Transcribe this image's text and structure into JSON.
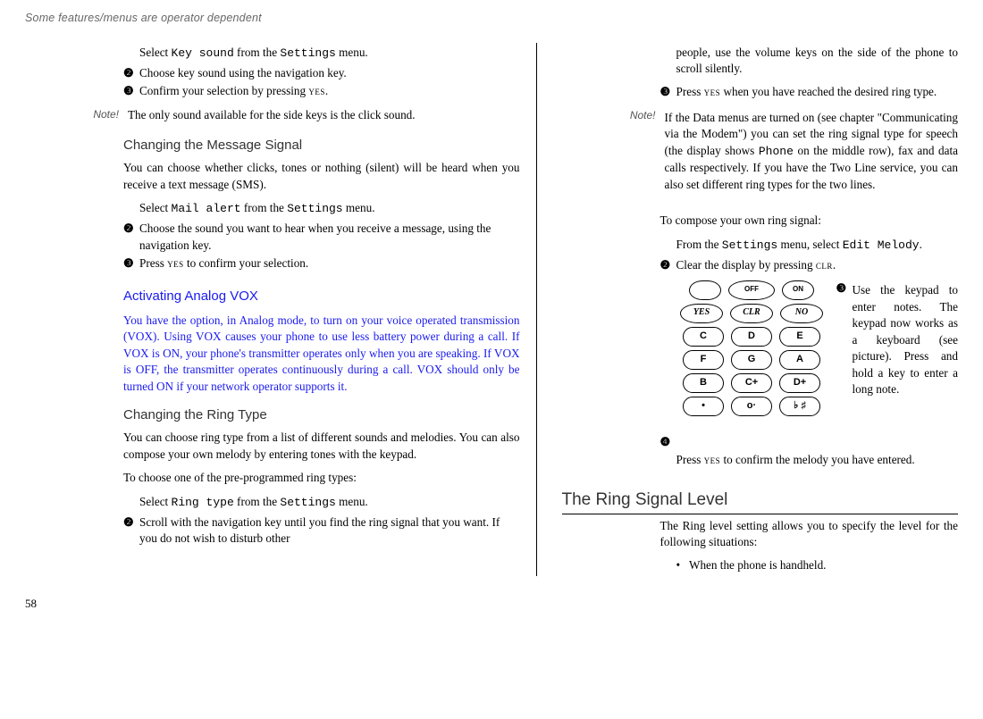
{
  "header": {
    "op": "Some features/menus are operator dependent"
  },
  "left": {
    "sel1a": "Select ",
    "sel1b": "Key sound",
    "sel1c": " from the ",
    "sel1d": "Settings",
    "sel1e": " menu.",
    "b2": "Choose key sound using the navigation key.",
    "b3a": "Confirm your selection by pressing ",
    "b3b": "yes",
    "b3c": ".",
    "noteLbl": "Note!",
    "noteTxt": "The only sound available for the side keys is the click sound.",
    "h3a": "Changing the Message Signal",
    "p1": "You can choose whether clicks, tones or nothing (silent) will be heard when you receive a text message (SMS).",
    "sel2a": "Select ",
    "sel2b": "Mail alert",
    "sel2c": " from the ",
    "sel2d": "Settings",
    "sel2e": " menu.",
    "b4": "Choose the sound you want to hear when you receive a message, using the navigation key.",
    "b5a": "Press ",
    "b5b": "yes",
    "b5c": " to confirm your selection.",
    "h3b": "Activating Analog VOX",
    "p2": "You have the option, in Analog mode, to turn on your voice operated transmission (VOX). Using VOX causes your phone to use less battery power during a call. If VOX is ON, your phone's transmitter operates only when you are speaking.  If VOX is OFF, the transmitter operates continuously during a call. VOX should only be turned ON if your network operator supports it.",
    "h3c": "Changing the Ring Type",
    "p3": "You can choose ring type from a list of different sounds and melodies. You can also compose your own melody by entering tones with the keypad.",
    "p4": "To choose one of the pre-programmed ring types:",
    "sel3a": "Select ",
    "sel3b": "Ring type",
    "sel3c": " from the ",
    "sel3d": "Settings",
    "sel3e": " menu.",
    "b6": "Scroll with the navigation key until you find the ring signal that you want. If you do not wish to disturb other "
  },
  "right": {
    "cont": "people, use the volume keys on the side of the phone to scroll silently.",
    "b3a": "Press ",
    "b3b": "yes",
    "b3c": " when you have reached the desired ring type.",
    "noteLbl": "Note!",
    "noteTxt1": "If the Data menus are turned on (see chapter \"Communicating via the Modem\") you can set the ring signal type for speech (the display shows ",
    "noteTxt2": "Phone",
    "noteTxt3": " on the middle row), fax and data calls respectively. If you have the Two Line service, you can also set different ring types for the two lines.",
    "p1": "To compose your own ring signal:",
    "sel1a": "From the ",
    "sel1b": "Settings",
    "sel1c": " menu, select ",
    "sel1d": "Edit Melody",
    "sel1e": ".",
    "b2a": "Clear the display by pressing ",
    "b2b": "clr",
    "b2c": ".",
    "side": "Use the keypad to enter notes. The keypad now works as a keyboard (see picture). Press and hold a key to enter a long note.",
    "b4a": "Press ",
    "b4b": "yes",
    "b4c": " to confirm the melody you have entered.",
    "h2": "The Ring Signal Level",
    "p2": "The Ring level setting allows you to specify the level for the following situations:",
    "li1": "When the phone is handheld."
  },
  "keys": {
    "yes": "YES",
    "clr": "CLR",
    "no": "NO",
    "off": "OFF",
    "on": "ON",
    "c": "C",
    "d": "D",
    "e": "E",
    "f": "F",
    "g": "G",
    "a": "A",
    "b": "B",
    "cp": "C+",
    "dp": "D+",
    "dot": "•",
    "o": "o·",
    "sharp": "♭ ♯"
  },
  "bn": {
    "n2": "❷",
    "n3": "❸",
    "n4": "❹"
  },
  "page": "58"
}
